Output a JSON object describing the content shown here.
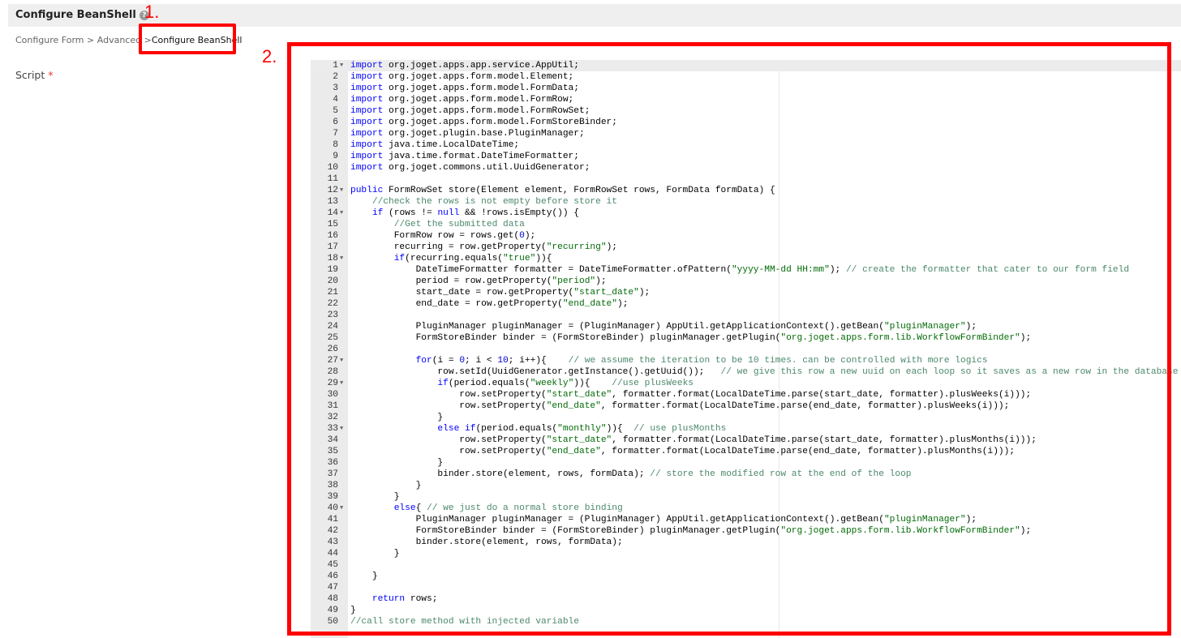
{
  "header": {
    "title": "Configure BeanShell",
    "help_icon": "question-circle-icon"
  },
  "breadcrumb": [
    {
      "label": "Configure Form"
    },
    {
      "label": "Advanced"
    },
    {
      "label": "Configure BeanShell"
    }
  ],
  "breadcrumb_separator": ">",
  "form": {
    "script_label": "Script",
    "required_marker": "*"
  },
  "annotations": {
    "one": "1.",
    "two": "2.",
    "color": "#ff0000"
  },
  "editor": {
    "fold_lines": [
      1,
      12,
      14,
      18,
      27,
      29,
      33,
      40
    ],
    "lines": [
      "import org.joget.apps.app.service.AppUtil;",
      "import org.joget.apps.form.model.Element;",
      "import org.joget.apps.form.model.FormData;",
      "import org.joget.apps.form.model.FormRow;",
      "import org.joget.apps.form.model.FormRowSet;",
      "import org.joget.apps.form.model.FormStoreBinder;",
      "import org.joget.plugin.base.PluginManager;",
      "import java.time.LocalDateTime;",
      "import java.time.format.DateTimeFormatter;",
      "import org.joget.commons.util.UuidGenerator;",
      "",
      "public FormRowSet store(Element element, FormRowSet rows, FormData formData) {",
      "    //check the rows is not empty before store it",
      "    if (rows != null && !rows.isEmpty()) {",
      "        //Get the submitted data",
      "        FormRow row = rows.get(0);",
      "        recurring = row.getProperty(\"recurring\");",
      "        if(recurring.equals(\"true\")){",
      "            DateTimeFormatter formatter = DateTimeFormatter.ofPattern(\"yyyy-MM-dd HH:mm\"); // create the formatter that cater to our form field",
      "            period = row.getProperty(\"period\");",
      "            start_date = row.getProperty(\"start_date\");",
      "            end_date = row.getProperty(\"end_date\");",
      "",
      "            PluginManager pluginManager = (PluginManager) AppUtil.getApplicationContext().getBean(\"pluginManager\");",
      "            FormStoreBinder binder = (FormStoreBinder) pluginManager.getPlugin(\"org.joget.apps.form.lib.WorkflowFormBinder\");",
      "",
      "            for(i = 0; i < 10; i++){    // we assume the iteration to be 10 times. can be controlled with more logics",
      "                row.setId(UuidGenerator.getInstance().getUuid());   // we give this row a new uuid on each loop so it saves as a new row in the database",
      "                if(period.equals(\"weekly\")){    //use plusWeeks",
      "                    row.setProperty(\"start_date\", formatter.format(LocalDateTime.parse(start_date, formatter).plusWeeks(i)));",
      "                    row.setProperty(\"end_date\", formatter.format(LocalDateTime.parse(end_date, formatter).plusWeeks(i)));",
      "                }",
      "                else if(period.equals(\"monthly\")){  // use plusMonths",
      "                    row.setProperty(\"start_date\", formatter.format(LocalDateTime.parse(start_date, formatter).plusMonths(i)));",
      "                    row.setProperty(\"end_date\", formatter.format(LocalDateTime.parse(end_date, formatter).plusMonths(i)));",
      "                }",
      "                binder.store(element, rows, formData); // store the modified row at the end of the loop",
      "            }",
      "        }",
      "        else{ // we just do a normal store binding",
      "            PluginManager pluginManager = (PluginManager) AppUtil.getApplicationContext().getBean(\"pluginManager\");",
      "            FormStoreBinder binder = (FormStoreBinder) pluginManager.getPlugin(\"org.joget.apps.form.lib.WorkflowFormBinder\");",
      "            binder.store(element, rows, formData);",
      "        }",
      "",
      "    }",
      "",
      "    return rows;",
      "}",
      "//call store method with injected variable"
    ]
  }
}
